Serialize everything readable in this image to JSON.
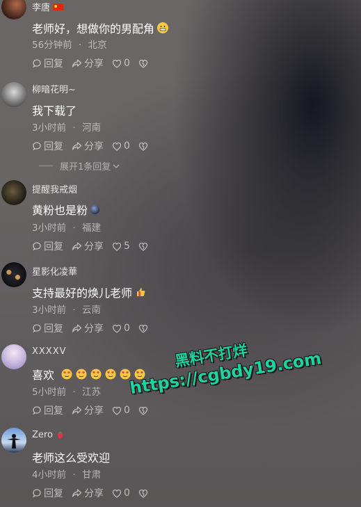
{
  "comments": [
    {
      "username": "李唐",
      "text": "老师好，想做你的男配角",
      "time": "56分钟前",
      "location": "北京",
      "reply_label": "回复",
      "share_label": "分享",
      "likes": "0"
    },
    {
      "username": "柳暗花明~",
      "text": "我下载了",
      "time": "3小时前",
      "location": "河南",
      "reply_label": "回复",
      "share_label": "分享",
      "likes": "0"
    },
    {
      "username": "提醒我戒烟",
      "text": "黄粉也是粉",
      "time": "3小时前",
      "location": "福建",
      "reply_label": "回复",
      "share_label": "分享",
      "likes": "5"
    },
    {
      "username": "星影化凌華",
      "text": "支持最好的焕儿老师",
      "time": "3小时前",
      "location": "云南",
      "reply_label": "回复",
      "share_label": "分享",
      "likes": "0"
    },
    {
      "username": "XXXXV",
      "text": "喜欢",
      "time": "5小时前",
      "location": "江苏",
      "reply_label": "回复",
      "share_label": "分享",
      "likes": "0"
    },
    {
      "username": "Zero",
      "text": "老师这么受欢迎",
      "time": "4小时前",
      "location": "甘肃",
      "reply_label": "回复",
      "share_label": "分享",
      "likes": "0"
    }
  ],
  "expand_replies": "展开1条回复",
  "meta_separator": "·",
  "watermark": {
    "line1": "黑料不打烊",
    "line2": "https://cgbdy19.com"
  },
  "icons": {
    "reply": "comment-bubble-icon",
    "share": "share-arrow-icon",
    "like": "heart-icon",
    "dislike": "broken-heart-icon"
  }
}
